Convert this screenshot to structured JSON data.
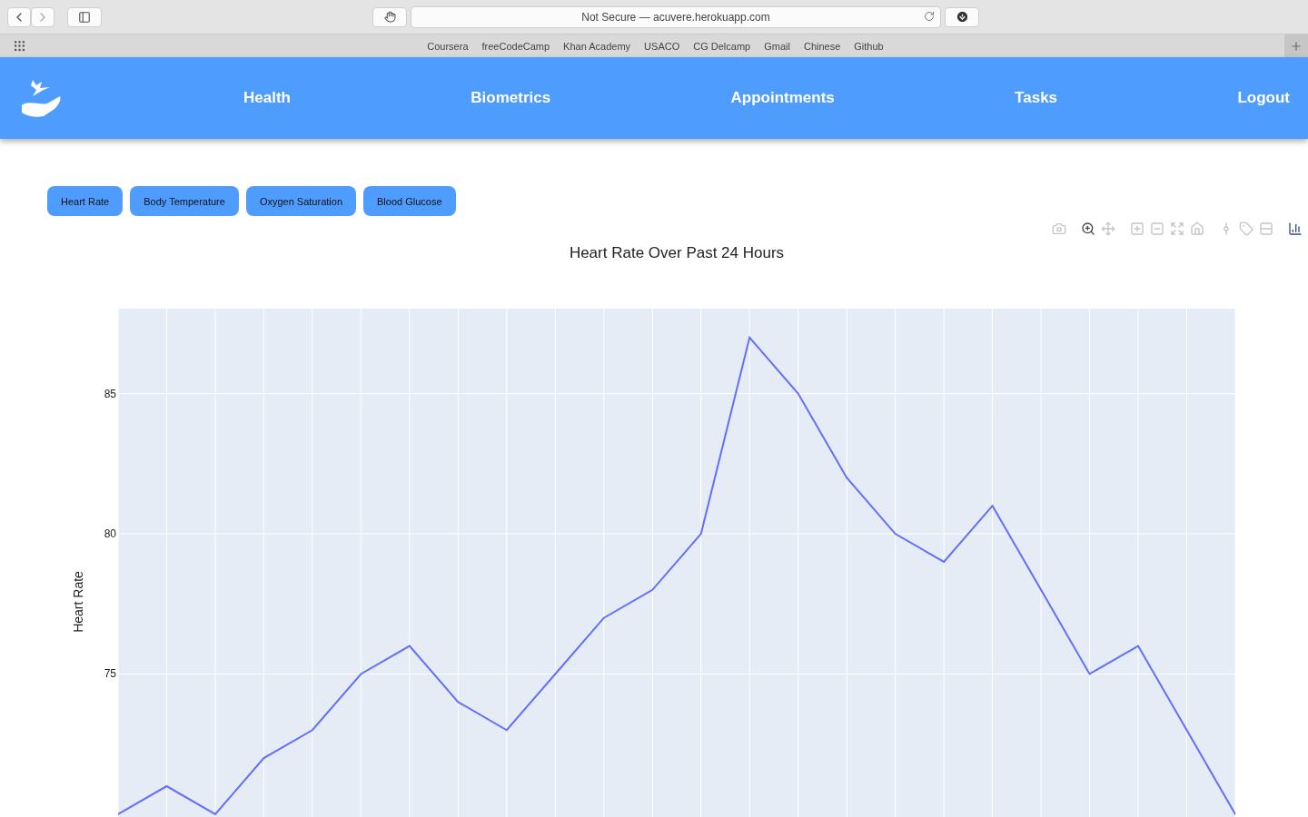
{
  "browser": {
    "address": "Not Secure — acuvere.herokuapp.com",
    "bookmarks": [
      "Coursera",
      "freeCodeCamp",
      "Khan Academy",
      "USACO",
      "CG Delcamp",
      "Gmail",
      "Chinese",
      "Github"
    ]
  },
  "nav": {
    "links": [
      "Health",
      "Biometrics",
      "Appointments",
      "Tasks",
      "Logout"
    ]
  },
  "metric_buttons": [
    "Heart Rate",
    "Body Temperature",
    "Oxygen Saturation",
    "Blood Glucose"
  ],
  "chart_data": {
    "type": "line",
    "title": "Heart Rate Over Past 24 Hours",
    "ylabel": "Heart Rate",
    "ylim": [
      69.9,
      88.03
    ],
    "yticks": [
      75,
      80,
      85
    ],
    "grid": true,
    "series": [
      {
        "color": "#636efa",
        "values": [
          70,
          71,
          70,
          72,
          73,
          75,
          76,
          74,
          73,
          75,
          77,
          78,
          80,
          87,
          85,
          82,
          80,
          79,
          81,
          78,
          75,
          76,
          73,
          70
        ]
      }
    ]
  }
}
